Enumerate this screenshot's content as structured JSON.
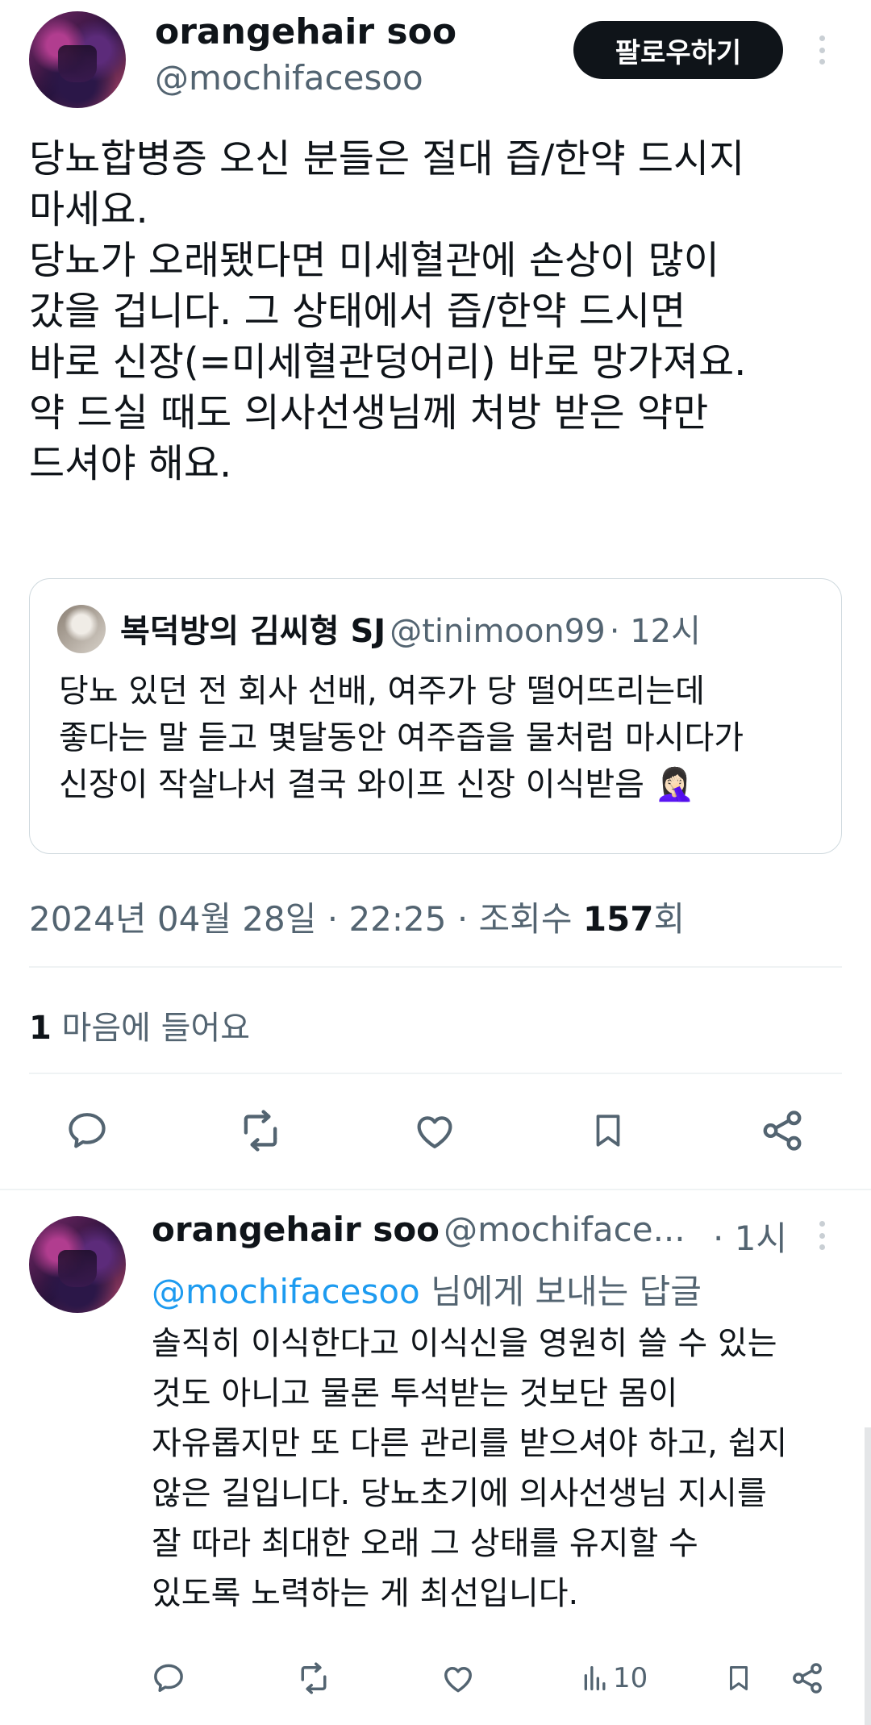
{
  "main_tweet": {
    "display_name": "orangehair soo",
    "handle": "@mochifacesoo",
    "follow_label": "팔로우하기",
    "text": "당뇨합병증 오신 분들은 절대 즙/한약 드시지\n마세요.\n당뇨가 오래됐다면 미세혈관에 손상이 많이\n갔을 겁니다. 그 상태에서 즙/한약 드시면\n바로 신장(=미세혈관덩어리) 바로 망가져요.\n약 드실 때도 의사선생님께 처방 받은 약만\n드셔야 해요.",
    "quote": {
      "display_name": "복덕방의 김씨형 SJ",
      "handle": "@tinimoon99",
      "time": "· 12시",
      "text": "당뇨 있던 전 회사 선배, 여주가 당 떨어뜨리는데\n좋다는 말 듣고 몇달동안 여주즙을 물처럼 마시다가\n신장이 작살나서 결국 와이프 신장 이식받음 🤦🏻‍♀️"
    },
    "date": "2024년 04월 28일 · 22:25 · 조회수 ",
    "views": "157",
    "views_suffix": "회",
    "likes_count": "1",
    "likes_label": " 마음에 들어요"
  },
  "reply": {
    "display_name": "orangehair soo",
    "handle": "@mochiface...",
    "time": "· 1시",
    "reply_to_mention": "@mochifacesoo",
    "reply_to_suffix": " 님에게 보내는 답글",
    "text": "솔직히 이식한다고 이식신을 영원히 쓸 수 있는\n것도 아니고 물론 투석받는 것보단 몸이\n자유롭지만 또 다른 관리를 받으셔야 하고, 쉽지\n않은 길입니다. 당뇨초기에 의사선생님 지시를\n잘 따라 최대한 오래 그 상태를 유지할 수\n있도록 노력하는 게 최선입니다.",
    "views_count": "10"
  },
  "icons": [
    "kebab-icon",
    "reply-icon",
    "retweet-icon",
    "like-icon",
    "bookmark-icon",
    "share-icon",
    "views-icon"
  ],
  "colors": {
    "text": "#0f1419",
    "secondary": "#536471",
    "link": "#1d9bf0",
    "divider": "#eff3f4"
  }
}
